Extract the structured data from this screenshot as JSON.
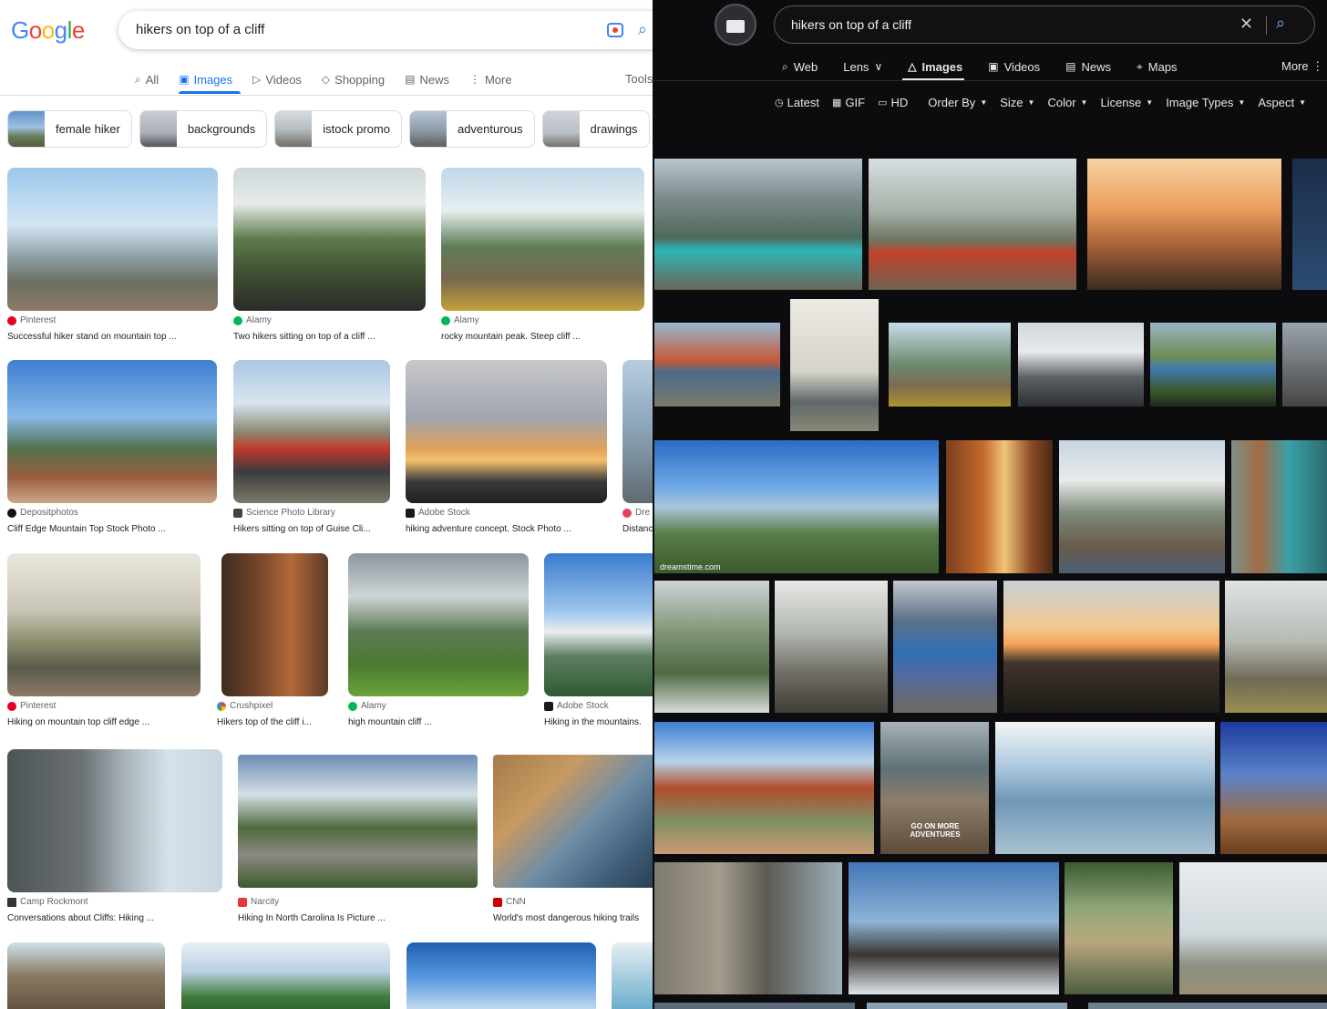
{
  "left": {
    "logo": {
      "letters": [
        "G",
        "o",
        "o",
        "g",
        "l",
        "e"
      ],
      "colors": [
        "#4285f4",
        "#ea4335",
        "#fbbc05",
        "#4285f4",
        "#34a853",
        "#ea4335"
      ]
    },
    "search": {
      "query": "hikers on top of a cliff"
    },
    "tabs": [
      {
        "label": "All",
        "icon": "search-icon"
      },
      {
        "label": "Images",
        "icon": "image-icon",
        "active": true
      },
      {
        "label": "Videos",
        "icon": "video-icon"
      },
      {
        "label": "Shopping",
        "icon": "tag-icon"
      },
      {
        "label": "News",
        "icon": "newspaper-icon"
      },
      {
        "label": "More",
        "icon": "kebab-icon"
      }
    ],
    "tools_label": "Tools",
    "chips": [
      "female hiker",
      "backgrounds",
      "istock promo",
      "adventurous",
      "drawings"
    ],
    "results": [
      {
        "source": "Pinterest",
        "title": "Successful hiker stand on mountain top ...",
        "fav": "#e60023"
      },
      {
        "source": "Alamy",
        "title": "Two hikers sitting on top of a cliff ...",
        "fav": "#00b956"
      },
      {
        "source": "Alamy",
        "title": "rocky mountain peak. Steep cliff ...",
        "fav": "#00b956"
      },
      {
        "source": "Depositphotos",
        "title": "Cliff Edge Mountain Top Stock Photo ...",
        "fav": "#111111"
      },
      {
        "source": "Science Photo Library",
        "title": "Hikers sitting on top of Guise Cli...",
        "fav": "#444444"
      },
      {
        "source": "Adobe Stock",
        "title": "hiking adventure concept. Stock Photo ...",
        "fav": "#1a1a1a"
      },
      {
        "source": "Dre",
        "title": "Distanc",
        "fav": "#e4405f"
      },
      {
        "source": "Pinterest",
        "title": "Hiking on mountain top cliff edge ...",
        "fav": "#e60023"
      },
      {
        "source": "Crushpixel",
        "title": "Hikers top of the cliff i...",
        "fav": "#6c5ce7"
      },
      {
        "source": "Alamy",
        "title": "high mountain cliff ...",
        "fav": "#00b956"
      },
      {
        "source": "Adobe Stock",
        "title": "Hiking in the mountains.",
        "fav": "#1a1a1a"
      },
      {
        "source": "Camp Rockmont",
        "title": "Conversations about Cliffs: Hiking ...",
        "fav": "#333333"
      },
      {
        "source": "Narcity",
        "title": "Hiking In North Carolina Is Picture ...",
        "fav": "#e53935"
      },
      {
        "source": "CNN",
        "title": "World's most dangerous hiking trails",
        "fav": "#cc0000"
      }
    ]
  },
  "right": {
    "search": {
      "query": "hikers on top of a cliff"
    },
    "tabs": [
      {
        "label": "Web",
        "icon": "search-icon"
      },
      {
        "label": "Lens",
        "icon": "chevron-down-icon"
      },
      {
        "label": "Images",
        "icon": "image-icon",
        "active": true
      },
      {
        "label": "Videos",
        "icon": "video-icon"
      },
      {
        "label": "News",
        "icon": "newspaper-icon"
      },
      {
        "label": "Maps",
        "icon": "map-pin-icon"
      }
    ],
    "more_label": "More",
    "filters": [
      {
        "label": "Latest",
        "icon": "clock-icon"
      },
      {
        "label": "GIF",
        "icon": "gif-icon"
      },
      {
        "label": "HD",
        "icon": "hd-icon"
      },
      {
        "label": "Order By",
        "dropdown": true
      },
      {
        "label": "Size",
        "dropdown": true
      },
      {
        "label": "Color",
        "dropdown": true
      },
      {
        "label": "License",
        "dropdown": true
      },
      {
        "label": "Image Types",
        "dropdown": true
      },
      {
        "label": "Aspect",
        "dropdown": true
      }
    ],
    "watermarks": [
      "dreamstime.com",
      "GO ON MORE ADVENTURES"
    ]
  }
}
